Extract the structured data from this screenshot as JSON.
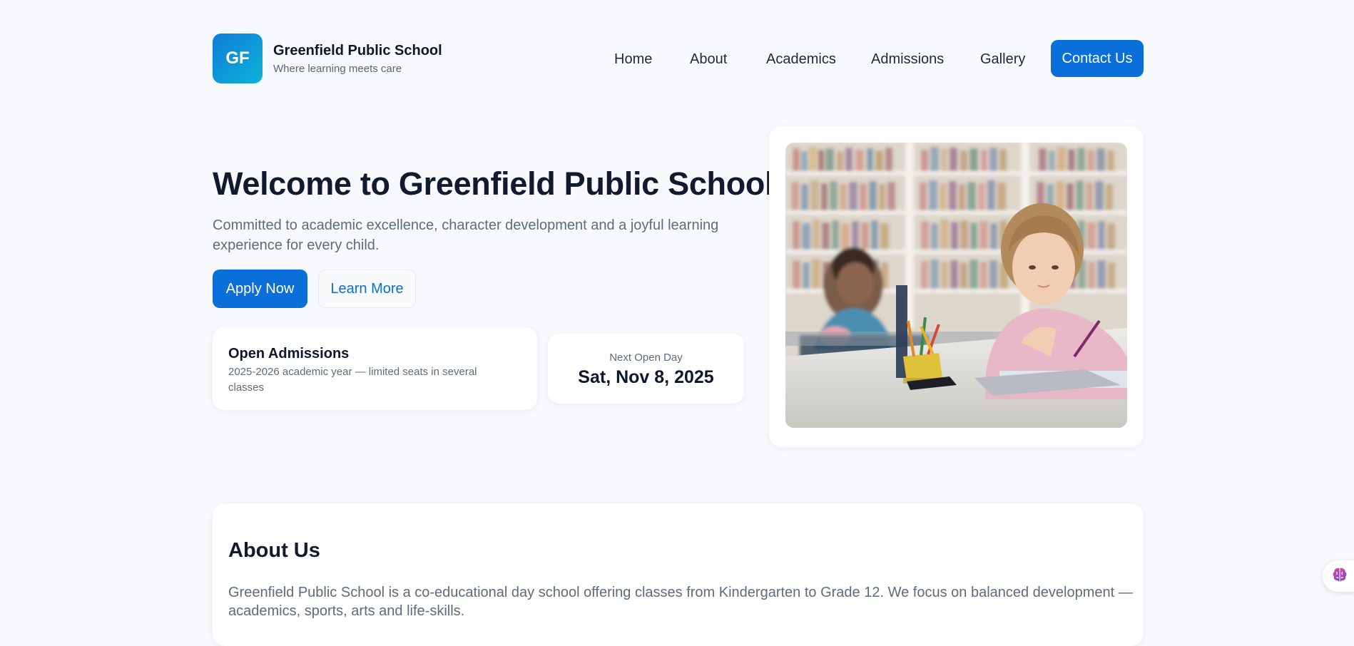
{
  "brand": {
    "logo_text": "GF",
    "name": "Greenfield Public School",
    "tagline": "Where learning meets care"
  },
  "nav": {
    "items": [
      {
        "label": "Home"
      },
      {
        "label": "About"
      },
      {
        "label": "Academics"
      },
      {
        "label": "Admissions"
      },
      {
        "label": "Gallery"
      }
    ],
    "cta_label": "Contact Us"
  },
  "hero": {
    "title": "Welcome to Greenfield Public School",
    "subtitle": "Committed to academic excellence, character development and a joyful learning experience for every child.",
    "primary_button": "Apply Now",
    "secondary_button": "Learn More",
    "image_icon": "classroom-photo"
  },
  "admissions_card": {
    "title": "Open Admissions",
    "description": "2025-2026 academic year — limited seats in several classes"
  },
  "open_day_card": {
    "label": "Next Open Day",
    "date": "Sat, Nov 8, 2025"
  },
  "about": {
    "title": "About Us",
    "text": "Greenfield Public School is a co-educational day school offering classes from Kindergarten to Grade 12. We focus on balanced development — academics, sports, arts and life-skills."
  },
  "floating_widget": {
    "icon": "brain-icon"
  },
  "colors": {
    "accent": "#0b6fd9",
    "logo_gradient_start": "#0e7bd9",
    "logo_gradient_end": "#0cb4d8",
    "background": "#f7f9fc",
    "heading": "#111a2e",
    "muted": "#5f6b7c"
  }
}
